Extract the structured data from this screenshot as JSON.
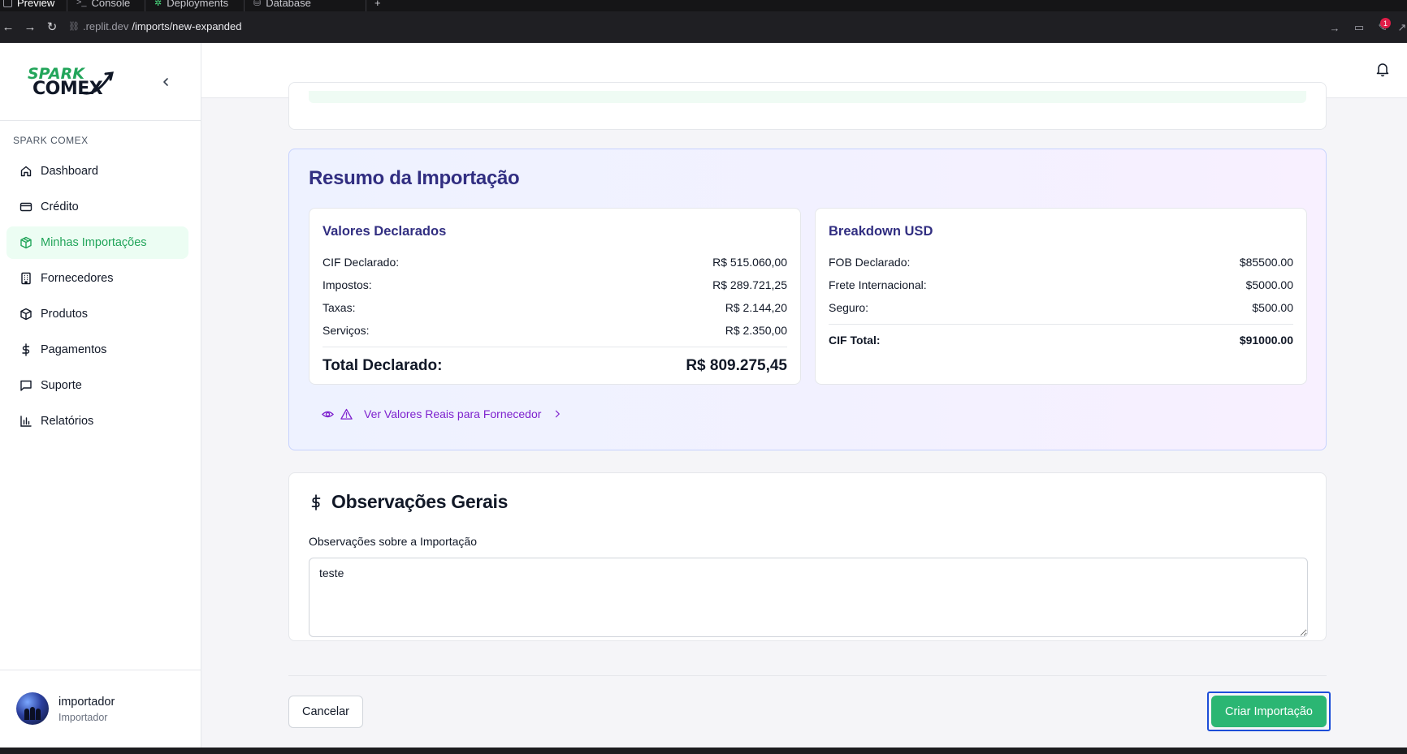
{
  "browser": {
    "tabs": [
      {
        "label": "Preview",
        "active": true
      },
      {
        "label": "Console",
        "active": false
      },
      {
        "label": "Deployments",
        "active": false
      },
      {
        "label": "Database",
        "active": false
      }
    ],
    "new_tab_symbol": "+",
    "url_domain": ".replit.dev",
    "url_path": "/imports/new-expanded",
    "notification_count": "1"
  },
  "sidebar": {
    "logo_line1": "SPARK",
    "logo_line2": "COMEX",
    "section_label": "SPARK COMEX",
    "items": [
      {
        "label": "Dashboard",
        "icon": "home-icon",
        "active": false
      },
      {
        "label": "Crédito",
        "icon": "credit-card-icon",
        "active": false
      },
      {
        "label": "Minhas Importações",
        "icon": "package-icon",
        "active": true
      },
      {
        "label": "Fornecedores",
        "icon": "building-icon",
        "active": false
      },
      {
        "label": "Produtos",
        "icon": "box-icon",
        "active": false
      },
      {
        "label": "Pagamentos",
        "icon": "dollar-icon",
        "active": false
      },
      {
        "label": "Suporte",
        "icon": "message-icon",
        "active": false
      },
      {
        "label": "Relatórios",
        "icon": "bar-chart-icon",
        "active": false
      }
    ],
    "user": {
      "name": "importador",
      "role": "Importador"
    }
  },
  "summary": {
    "title": "Resumo da Importação",
    "declared": {
      "title": "Valores Declarados",
      "rows": [
        {
          "label": "CIF Declarado:",
          "value": "R$ 515.060,00"
        },
        {
          "label": "Impostos:",
          "value": "R$ 289.721,25"
        },
        {
          "label": "Taxas:",
          "value": "R$ 2.144,20"
        },
        {
          "label": "Serviços:",
          "value": "R$ 2.350,00"
        }
      ],
      "total_label": "Total Declarado:",
      "total_value": "R$ 809.275,45"
    },
    "usd": {
      "title": "Breakdown USD",
      "rows": [
        {
          "label": "FOB Declarado:",
          "value": "$85500.00"
        },
        {
          "label": "Frete Internacional:",
          "value": "$5000.00"
        },
        {
          "label": "Seguro:",
          "value": "$500.00"
        }
      ],
      "total_label": "CIF Total:",
      "total_value": "$91000.00"
    },
    "real_values_link": "Ver Valores Reais para Fornecedor"
  },
  "observations": {
    "title": "Observações Gerais",
    "label": "Observações sobre a Importação",
    "value": "teste"
  },
  "actions": {
    "cancel": "Cancelar",
    "create": "Criar Importação"
  },
  "colors": {
    "brand_green": "#2bb673",
    "summary_title": "#312e81",
    "link_purple": "#7e22ce",
    "focus_blue": "#1d4ed8"
  }
}
